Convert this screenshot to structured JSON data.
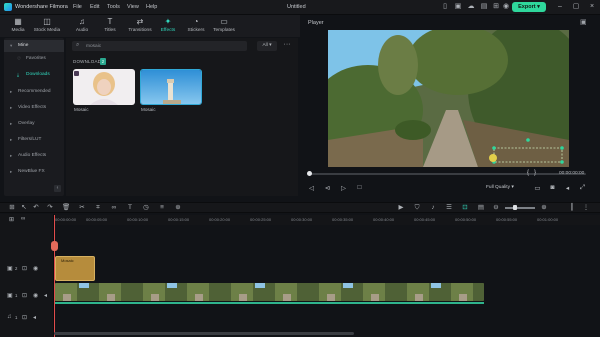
{
  "titlebar": {
    "app_name": "Wondershare Filmora",
    "menus": [
      "File",
      "Edit",
      "Tools",
      "View",
      "Help"
    ],
    "doc_title": "Untitled",
    "export_label": "Export",
    "icons": [
      "phone-icon",
      "gift-icon",
      "cloud-icon",
      "save-icon",
      "grid-icon",
      "avatar-icon"
    ]
  },
  "tabs": [
    {
      "label": "Media",
      "icon": "media-icon"
    },
    {
      "label": "Stock Media",
      "icon": "stock-icon"
    },
    {
      "label": "Audio",
      "icon": "music-icon"
    },
    {
      "label": "Titles",
      "icon": "titles-icon"
    },
    {
      "label": "Transitions",
      "icon": "transitions-icon"
    },
    {
      "label": "Effects",
      "icon": "effects-icon"
    },
    {
      "label": "Stickers",
      "icon": "stickers-icon"
    },
    {
      "label": "Templates",
      "icon": "templates-icon"
    }
  ],
  "active_tab": "Effects",
  "sidebar": {
    "items": [
      {
        "label": "Mine"
      },
      {
        "label": "Favorites"
      },
      {
        "label": "Downloads"
      },
      {
        "label": "Recommended"
      },
      {
        "label": "Video Effects"
      },
      {
        "label": "Overlay"
      },
      {
        "label": "Filters/LUT"
      },
      {
        "label": "Audio Effects"
      },
      {
        "label": "NewBlue FX"
      }
    ]
  },
  "browser": {
    "search_value": "mosaic",
    "filter_label": "All",
    "section_title": "DOWNLOADS",
    "section_count": "2",
    "items": [
      {
        "label": "Mosaic"
      },
      {
        "label": "Mosaic"
      }
    ]
  },
  "player": {
    "label": "Player",
    "timecode": "00:00:00:00",
    "quality_label": "Full Quality"
  },
  "timeline": {
    "ruler_ticks": [
      "00:00:00:00",
      "00:00:05:00",
      "00:00:10:00",
      "00:00:15:00",
      "00:00:20:00",
      "00:00:25:00",
      "00:00:30:00",
      "00:00:35:00",
      "00:00:40:00",
      "00:00:45:00",
      "00:00:50:00",
      "00:00:55:00",
      "00:01:00:00"
    ],
    "title_clip_label": "Mosaic",
    "track_numbers": [
      "2",
      "1",
      "1"
    ]
  },
  "colors": {
    "accent": "#31d7bd",
    "export": "#2fd79c",
    "playhead": "#e24c4c",
    "title_clip": "#b68c3c"
  }
}
